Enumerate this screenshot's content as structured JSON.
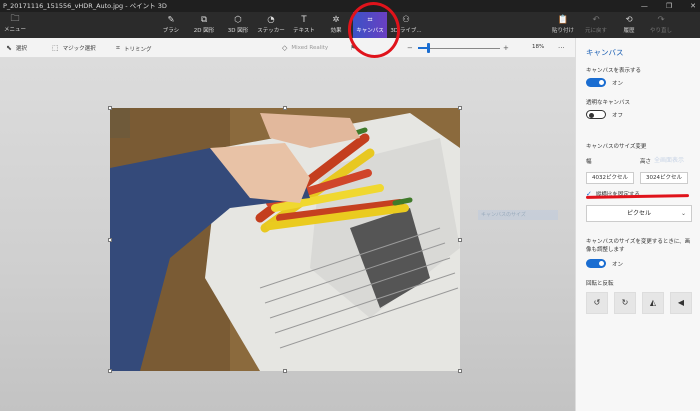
{
  "window": {
    "title": "P_20171116_151556_vHDR_Auto.jpg - ペイント 3D",
    "controls": [
      "—",
      "❐",
      "✕"
    ]
  },
  "ribbon": {
    "menu_label": "メニュー",
    "tools": [
      {
        "label": "ブラシ",
        "icon": "brush-icon"
      },
      {
        "label": "2D 図形",
        "icon": "2d-shapes-icon"
      },
      {
        "label": "3D 図形",
        "icon": "3d-shapes-icon"
      },
      {
        "label": "ステッカー",
        "icon": "stickers-icon"
      },
      {
        "label": "テキスト",
        "icon": "text-icon"
      },
      {
        "label": "効果",
        "icon": "effects-icon"
      },
      {
        "label": "キャンバス",
        "icon": "canvas-icon"
      },
      {
        "label": "3D ライブ...",
        "icon": "3d-library-icon"
      }
    ],
    "right": [
      {
        "label": "貼り付け",
        "icon": "paste-icon"
      },
      {
        "label": "元に戻す",
        "icon": "undo-icon"
      },
      {
        "label": "履歴",
        "icon": "history-icon"
      },
      {
        "label": "やり直し",
        "icon": "redo-icon"
      }
    ]
  },
  "subbar": {
    "select": "選択",
    "magic_select": "マジック選択",
    "crop": "トリミング",
    "mixed_reality": "Mixed Reality",
    "zoom": "18%"
  },
  "panel": {
    "title": "キャンバス",
    "show_canvas": "キャンバスを表示する",
    "show_canvas_state": "オン",
    "transparent_canvas": "透明なキャンバス",
    "transparent_canvas_state": "オフ",
    "resize_label": "キャンバスのサイズ変更",
    "width_label": "幅",
    "height_label": "高さ",
    "width_value": "4032ピクセル",
    "height_value": "3024ピクセル",
    "lock_aspect": "縦横比を固定する",
    "unit": "ピクセル",
    "resize_image": "キャンバスのサイズを変更するときに、画像も調整します",
    "resize_image_state": "オン",
    "rotate_flip": "回転と反転",
    "ghost_text": "全画面表示"
  },
  "canvas": {
    "watermark": "キャンバスのサイズ"
  }
}
